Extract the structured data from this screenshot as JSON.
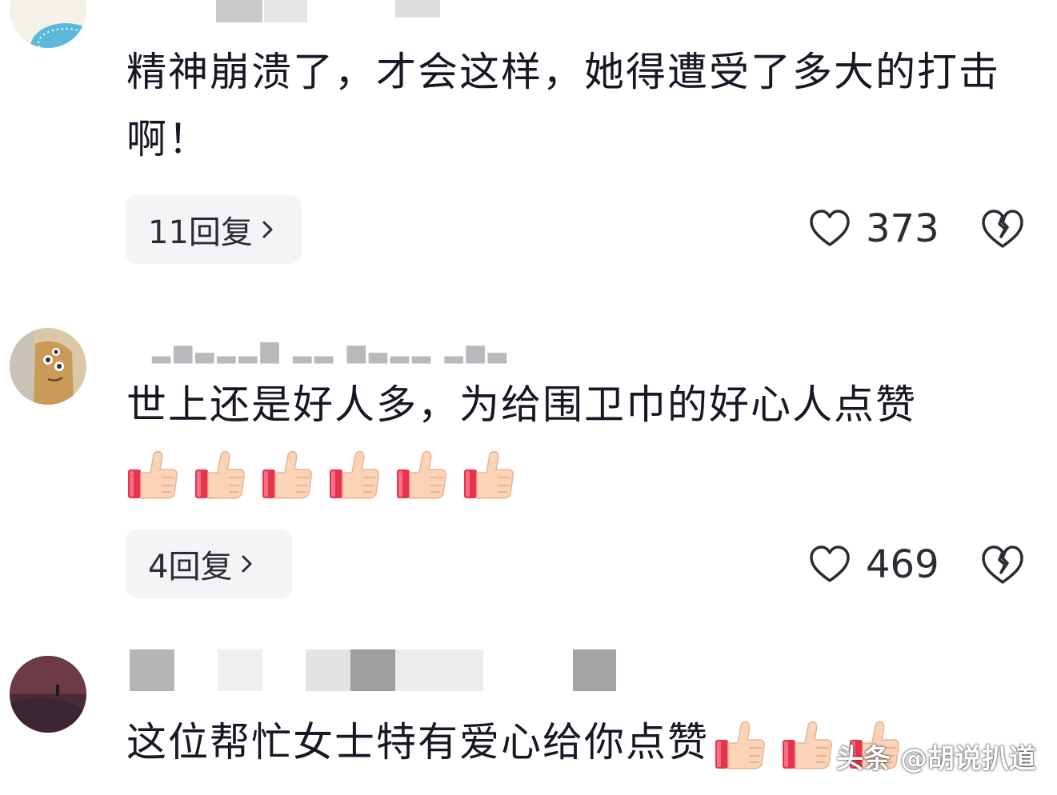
{
  "comments": [
    {
      "text": "精神崩溃了，才会这样，她得遭受了多大的打击啊！",
      "reply_label": "11回复",
      "likes": "373"
    },
    {
      "text": "世上还是好人多，为给围卫巾的好心人点赞",
      "thumbs_count": 6,
      "reply_label": "4回复",
      "likes": "469"
    },
    {
      "text": "这位帮忙女士特有爱心给你点赞",
      "thumbs_count": 3
    }
  ],
  "watermark": "头条 @胡说扒道",
  "icons": {
    "like": "heart-outline-icon",
    "dislike": "broken-heart-icon",
    "reply_more": "chevron-right-icon",
    "emoji": "thumbs-up-icon"
  },
  "colors": {
    "text": "#161823",
    "reply_bg": "#f4f4f6",
    "icon": "#2b2c33"
  }
}
